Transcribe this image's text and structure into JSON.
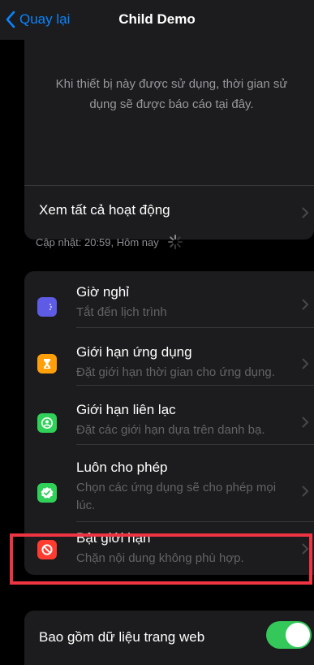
{
  "nav": {
    "back_label": "Quay lại",
    "title": "Child Demo"
  },
  "info": {
    "text": "Khi thiết bị này được sử dụng, thời gian sử dụng sẽ được báo cáo tại đây.",
    "see_all_label": "Xem tất cả hoạt động"
  },
  "updated": {
    "text": "Cập nhật: 20:59, Hôm nay"
  },
  "list": {
    "items": [
      {
        "title": "Giờ nghỉ",
        "subtitle": "Tắt đến lịch trình",
        "icon": "downtime-icon",
        "color": "#5e5ce6"
      },
      {
        "title": "Giới hạn ứng dụng",
        "subtitle": "Đặt giới hạn thời gian cho ứng dụng.",
        "icon": "hourglass-icon",
        "color": "#ff9f0a"
      },
      {
        "title": "Giới hạn liên lạc",
        "subtitle": "Đặt các giới hạn dựa trên danh bạ.",
        "icon": "contact-icon",
        "color": "#30d158"
      },
      {
        "title": "Luôn cho phép",
        "subtitle": "Chọn các ứng dụng sẽ cho phép mọi lúc.",
        "icon": "checkmark-badge-icon",
        "color": "#30d158"
      },
      {
        "title": "Bật giới hạn",
        "subtitle": "Chặn nội dung không phù hợp.",
        "icon": "restriction-icon",
        "color": "#ff3b30"
      }
    ]
  },
  "toggle": {
    "label": "Bao gồm dữ liệu trang web",
    "on": true,
    "color": "#34c759"
  },
  "highlight_color": "#ee3342",
  "accent": "#0a84ff"
}
